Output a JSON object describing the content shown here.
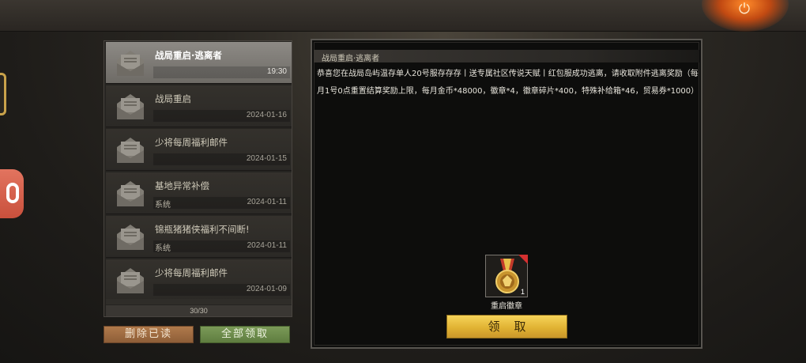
{
  "header": {
    "power_icon": "power-icon",
    "power_glyph": "⏻"
  },
  "mail_list": {
    "items": [
      {
        "title": "战局重启·逃离者",
        "sender": "",
        "date": "19:30",
        "selected": true
      },
      {
        "title": "战局重启",
        "sender": "",
        "date": "2024-01-16",
        "selected": false
      },
      {
        "title": "少将每周福利邮件",
        "sender": "",
        "date": "2024-01-15",
        "selected": false
      },
      {
        "title": "基地异常补偿",
        "sender": "系统",
        "date": "2024-01-11",
        "selected": false
      },
      {
        "title": "锦瓶猪猪侠福利不间断!",
        "sender": "系统",
        "date": "2024-01-11",
        "selected": false
      },
      {
        "title": "少将每周福利邮件",
        "sender": "",
        "date": "2024-01-09",
        "selected": false
      }
    ],
    "count": "30/30"
  },
  "buttons": {
    "delete_read": "删除已读",
    "claim_all": "全部领取",
    "claim": "领取"
  },
  "detail": {
    "title": "战局重启·逃离者",
    "body": "恭喜您在战局岛屿温存单人20号服存存存丨送专属社区传说天赋丨红包服成功逃离，请收取附件逃离奖励（每月1号0点重置结算奖励上限，每月金币*48000，徽章*4，徽章碎片*400，特殊补给箱*46，贸易券*1000）",
    "attachment": {
      "name": "重启徽章",
      "count": "1",
      "icon": "medal-icon"
    }
  },
  "colors": {
    "selected_row": "#8d8a85",
    "delete_button": "#b07a4b",
    "claim_all_button": "#7b9a58",
    "claim_button": "#f0c84a",
    "badge_red": "#d43030"
  }
}
